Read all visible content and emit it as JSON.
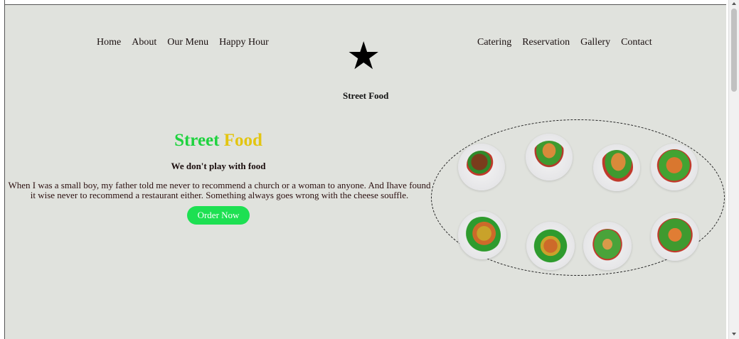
{
  "nav": {
    "left": [
      "Home",
      "About",
      "Our Menu",
      "Happy Hour"
    ],
    "right": [
      "Catering",
      "Reservation",
      "Gallery",
      "Contact"
    ]
  },
  "logo": {
    "icon": "star-icon",
    "text": "Street Food"
  },
  "hero": {
    "title_word1": "Street",
    "title_word2": "Food",
    "subtitle": "We don't play with food",
    "text": "When I was a small boy, my father told me never to recommend a church or a woman to anyone. And Ihave found it wise never to recommend a restaurant either. Something always goes wrong with the cheese souffle.",
    "button": "Order Now"
  },
  "colors": {
    "background": "#e0e2dd",
    "title_green": "#1fd33f",
    "title_yellow": "#e3c511",
    "button": "#1de052"
  }
}
